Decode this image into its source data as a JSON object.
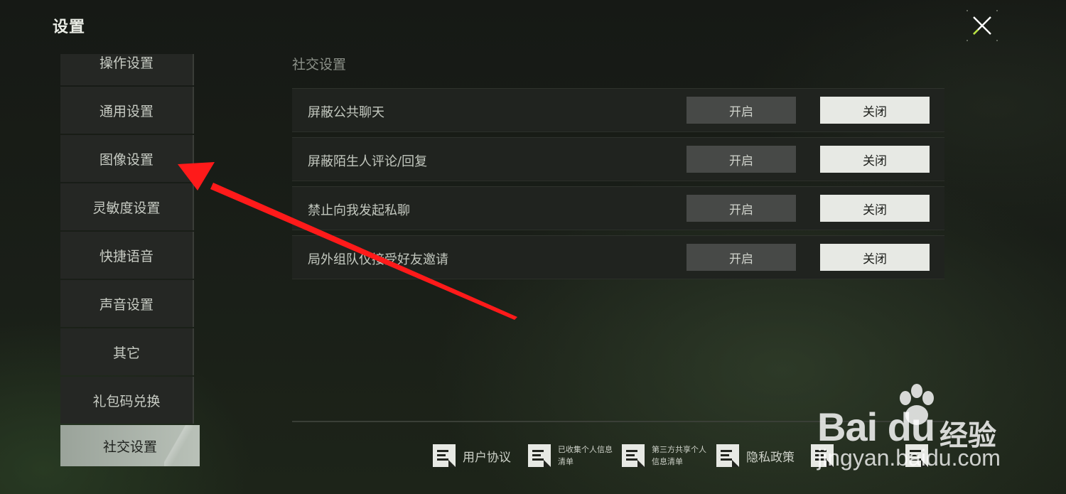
{
  "header": {
    "title": "设置",
    "close_icon": "close-x-icon"
  },
  "sidebar": {
    "items": [
      {
        "label": "操作设置"
      },
      {
        "label": "通用设置"
      },
      {
        "label": "图像设置"
      },
      {
        "label": "灵敏度设置"
      },
      {
        "label": "快捷语音"
      },
      {
        "label": "声音设置"
      },
      {
        "label": "其它"
      },
      {
        "label": "礼包码兑换"
      },
      {
        "label": "社交设置",
        "active": true
      }
    ]
  },
  "main": {
    "section_title": "社交设置",
    "settings": [
      {
        "label": "屏蔽公共聊天",
        "on_label": "开启",
        "off_label": "关闭",
        "selected": "off"
      },
      {
        "label": "屏蔽陌生人评论/回复",
        "on_label": "开启",
        "off_label": "关闭",
        "selected": "off"
      },
      {
        "label": "禁止向我发起私聊",
        "on_label": "开启",
        "off_label": "关闭",
        "selected": "off"
      },
      {
        "label": "局外组队仅接受好友邀请",
        "on_label": "开启",
        "off_label": "关闭",
        "selected": "off"
      }
    ]
  },
  "footer": {
    "links": [
      {
        "label": "用户协议",
        "icon": "document-icon"
      },
      {
        "label_line1": "已收集个人信息",
        "label_line2": "清单",
        "icon": "document-icon"
      },
      {
        "label_line1": "第三方共享个人",
        "label_line2": "信息清单",
        "icon": "document-icon"
      },
      {
        "label": "隐私政策",
        "icon": "document-icon"
      }
    ]
  },
  "annotation": {
    "arrow_color": "#ff1a1a"
  },
  "watermark": {
    "brand": "Bai du",
    "brand_cn": "经验",
    "url": "jingyan.baidu.com"
  },
  "colors": {
    "background": "#161a15",
    "panel_row": "#20231f",
    "toggle_on_bg": "#474947",
    "toggle_off_bg": "#e7e9e4",
    "active_tab": "#b9c1b8"
  }
}
